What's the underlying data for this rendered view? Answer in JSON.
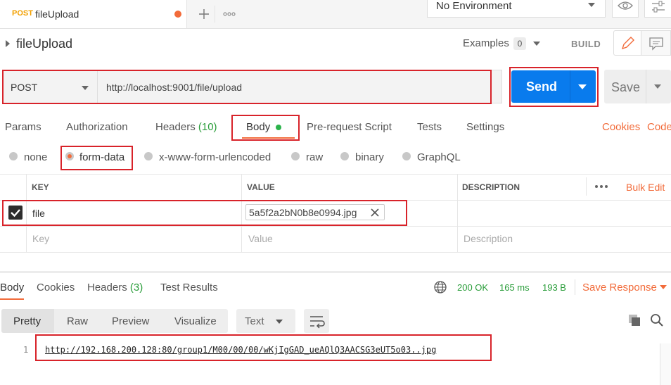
{
  "request_tab": {
    "method": "POST",
    "name": "fileUpload"
  },
  "env": {
    "label": "No Environment"
  },
  "request": {
    "name": "fileUpload",
    "examples_label": "Examples",
    "examples_count": "0",
    "build_label": "BUILD",
    "method": "POST",
    "url": "http://localhost:9001/file/upload",
    "send_label": "Send",
    "save_label": "Save"
  },
  "req_tabs": {
    "params": "Params",
    "authorization": "Authorization",
    "headers": "Headers",
    "headers_count": "(10)",
    "body": "Body",
    "prerequest": "Pre-request Script",
    "tests": "Tests",
    "settings": "Settings",
    "cookies": "Cookies",
    "code": "Code"
  },
  "body_types": {
    "none": "none",
    "form_data": "form-data",
    "urlencoded": "x-www-form-urlencoded",
    "raw": "raw",
    "binary": "binary",
    "graphql": "GraphQL"
  },
  "table": {
    "key_header": "KEY",
    "value_header": "VALUE",
    "desc_header": "DESCRIPTION",
    "bulk_edit": "Bulk Edit",
    "row": {
      "key": "file",
      "value": "5a5f2a2bN0b8e0994.jpg"
    },
    "placeholders": {
      "key": "Key",
      "value": "Value",
      "desc": "Description"
    }
  },
  "resp_tabs": {
    "body": "Body",
    "cookies": "Cookies",
    "headers": "Headers",
    "headers_count": "(3)",
    "test_results": "Test Results"
  },
  "status": {
    "code": "200 OK",
    "time": "165 ms",
    "size": "193 B",
    "save_response": "Save Response"
  },
  "view": {
    "pretty": "Pretty",
    "raw": "Raw",
    "preview": "Preview",
    "visualize": "Visualize",
    "format": "Text"
  },
  "response": {
    "line_no": "1",
    "text": "http://192.168.200.128:80/group1/M00/00/00/wKjIgGAD_ueAQlQ3AACSG3eUT5o03..jpg"
  },
  "colors": {
    "accent": "#f26b3a",
    "send": "#097bed",
    "ok": "#2a9d3a",
    "highlight": "#d8232a"
  }
}
